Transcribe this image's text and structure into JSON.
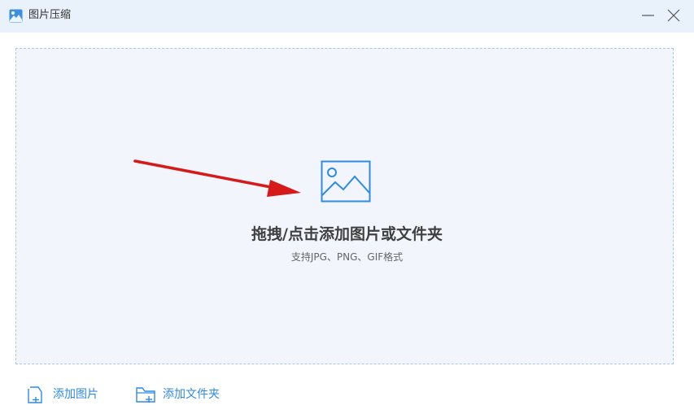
{
  "window": {
    "title": "图片压缩",
    "app_icon": "picture-app-icon",
    "minimize_icon": "minimize-icon",
    "close_icon": "close-icon"
  },
  "dropzone": {
    "icon": "image-icon",
    "title": "拖拽/点击添加图片或文件夹",
    "subtitle": "支持JPG、PNG、GIF格式"
  },
  "annotation": {
    "icon": "red-arrow",
    "color": "#d61a1a"
  },
  "actions": {
    "add_image_label": "添加图片",
    "add_image_icon": "add-file-icon",
    "add_folder_label": "添加文件夹",
    "add_folder_icon": "add-folder-icon"
  },
  "colors": {
    "titlebar_bg": "#e9f1fb",
    "dropzone_bg": "#f2f6fc",
    "accent": "#2e8ae6"
  }
}
